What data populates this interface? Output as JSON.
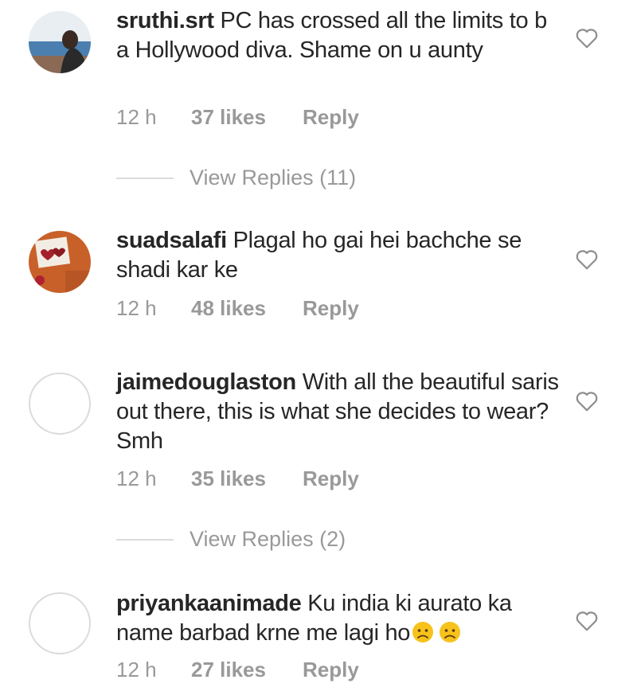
{
  "comments": [
    {
      "username": "sruthi.srt",
      "text": "PC has crossed all the limits to b a Hollywood diva. Shame on u aunty",
      "time": "12 h",
      "likes": "37 likes",
      "reply": "Reply",
      "view_replies": "View Replies (11)",
      "avatar": "photo-avatar",
      "like_icon": "heart-outline-icon"
    },
    {
      "username": "suadsalafi",
      "text": "Plagal ho gai hei bachche se shadi kar ke",
      "time": "12 h",
      "likes": "48 likes",
      "reply": "Reply",
      "avatar": "photo-avatar",
      "like_icon": "heart-outline-icon"
    },
    {
      "username": "jaimedouglaston",
      "text": "With all the beautiful saris out there, this is what she decides to wear? Smh",
      "time": "12 h",
      "likes": "35 likes",
      "reply": "Reply",
      "view_replies": "View Replies (2)",
      "avatar": "default-avatar",
      "like_icon": "heart-outline-icon"
    },
    {
      "username": "priyankaanimade",
      "text": "Ku india ki aurato ka name barbad krne me lagi ho",
      "emojis": [
        "confused-face-emoji",
        "confused-face-emoji"
      ],
      "time": "12 h",
      "likes": "27 likes",
      "reply": "Reply",
      "avatar": "default-avatar",
      "like_icon": "heart-outline-icon"
    }
  ],
  "colors": {
    "text": "#262626",
    "meta": "#999999",
    "divider": "#dbdbdb"
  }
}
